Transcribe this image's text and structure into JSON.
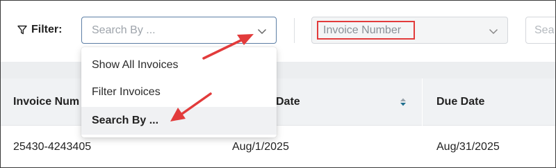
{
  "filter": {
    "label": "Filter:",
    "search_by_placeholder": "Search By ...",
    "field_value": "Invoice Number",
    "search_placeholder": "Sea"
  },
  "dropdown": {
    "items": [
      "Show All Invoices",
      "Filter Invoices",
      "Search By ..."
    ],
    "selected_index": 2
  },
  "table": {
    "headers": [
      "Invoice Num",
      "Date",
      "Due Date"
    ],
    "rows": [
      [
        "25430-4243405",
        "Aug/1/2025",
        "Aug/31/2025"
      ]
    ]
  },
  "colors": {
    "annotation": "#e23b3b",
    "focus_border": "#5d7fa6",
    "sort_icon": "#1f6f8f"
  },
  "icons": [
    "filter-funnel-icon",
    "chevron-down-icon",
    "sort-icon"
  ]
}
